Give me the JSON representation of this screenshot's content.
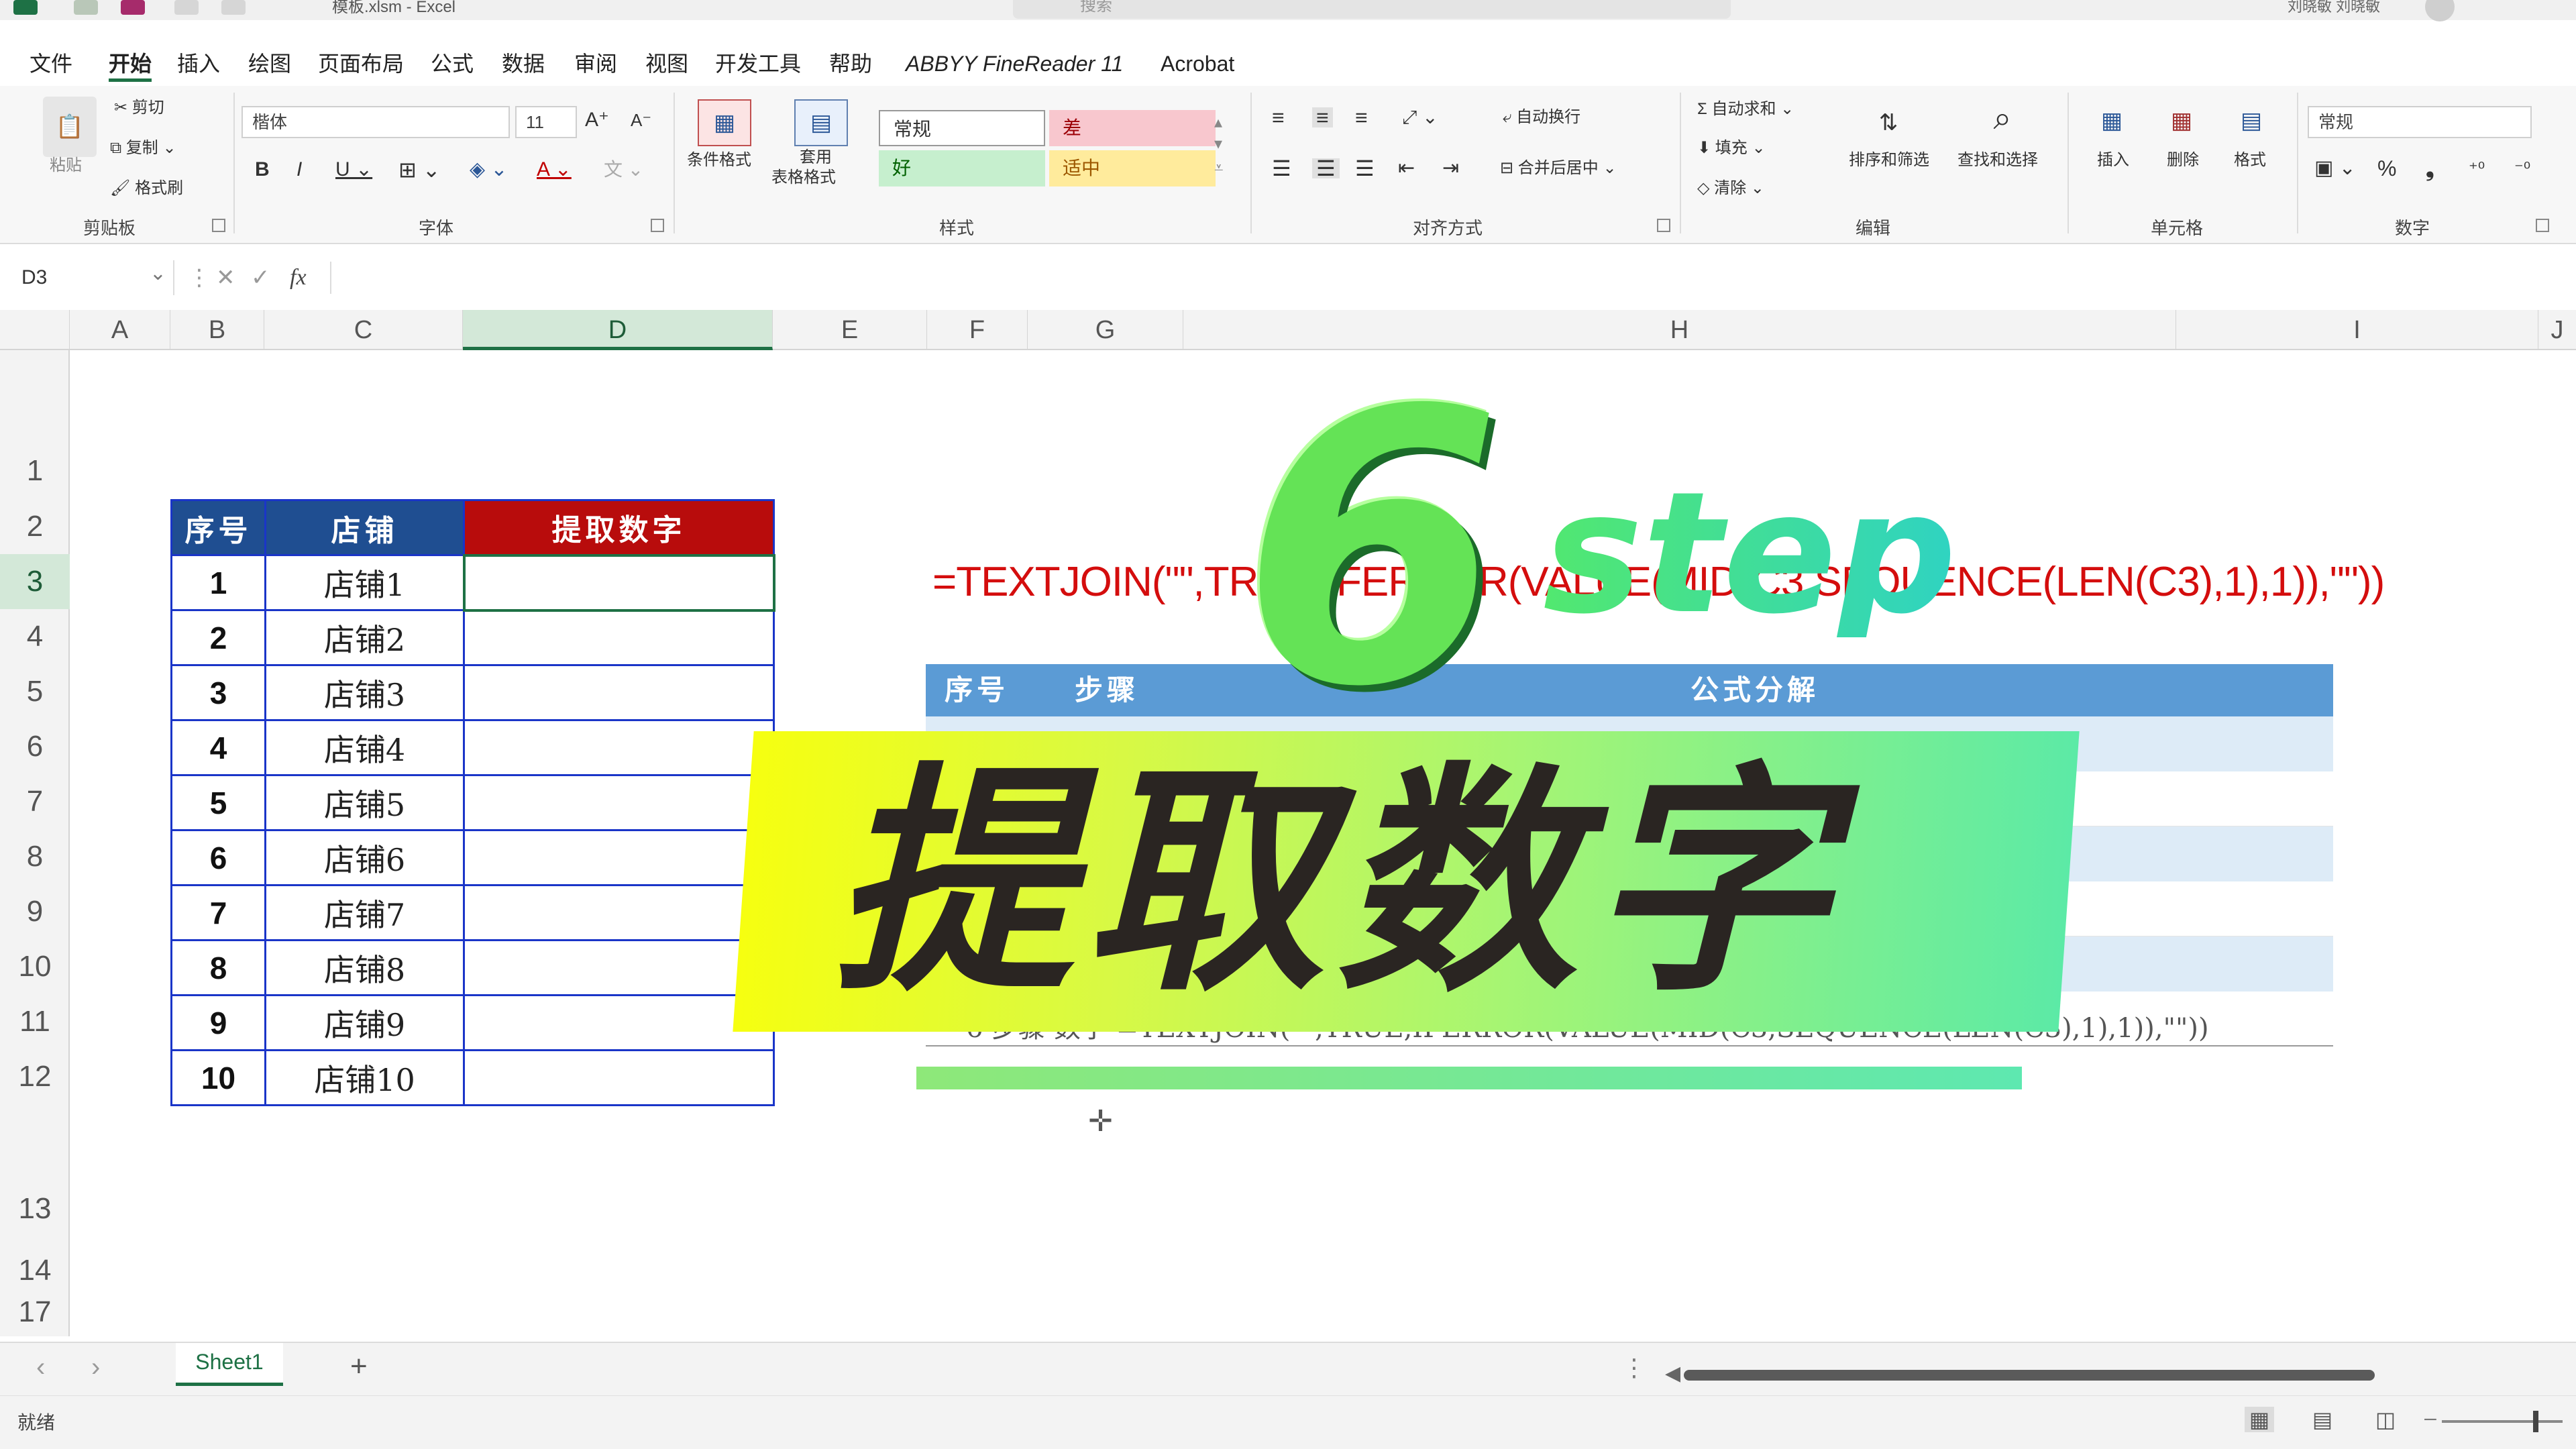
{
  "titlebar": {
    "filename": "模板.xlsm - Excel",
    "search_placeholder": "搜索",
    "user": "刘晓敏 刘晓敏"
  },
  "menu": {
    "tabs": [
      {
        "label": "文件"
      },
      {
        "label": "开始"
      },
      {
        "label": "插入"
      },
      {
        "label": "绘图"
      },
      {
        "label": "页面布局"
      },
      {
        "label": "公式"
      },
      {
        "label": "数据"
      },
      {
        "label": "审阅"
      },
      {
        "label": "视图"
      },
      {
        "label": "开发工具"
      },
      {
        "label": "帮助"
      },
      {
        "label": "ABBYY FineReader 11"
      },
      {
        "label": "Acrobat"
      }
    ]
  },
  "ribbon": {
    "clipboard": {
      "paste": "粘贴",
      "cut": "剪切",
      "copy": "复制",
      "format_painter": "格式刷",
      "group": "剪贴板"
    },
    "font": {
      "family": "楷体",
      "size": "11",
      "group": "字体"
    },
    "styles": {
      "conditional": "条件格式",
      "table_format": "套用\n表格格式",
      "table_format_l1": "套用",
      "table_format_l2": "表格格式",
      "normal": "常规",
      "bad": "差",
      "good": "好",
      "neutral": "适中",
      "group": "样式"
    },
    "alignment": {
      "wrap": "自动换行",
      "merge": "合并后居中",
      "group": "对齐方式"
    },
    "editing": {
      "autosum": "自动求和",
      "fill": "填充",
      "clear": "清除",
      "sort_filter": "排序和筛选",
      "find_select": "查找和选择",
      "group": "编辑"
    },
    "cells": {
      "insert": "插入",
      "delete": "删除",
      "format": "格式",
      "group": "单元格"
    },
    "number": {
      "format": "常规",
      "group": "数字"
    }
  },
  "formula_bar": {
    "name_box": "D3",
    "fx": "fx",
    "cancel": "✕",
    "enter": "✓",
    "more": "⋮"
  },
  "columns": [
    {
      "label": "A"
    },
    {
      "label": "B"
    },
    {
      "label": "C"
    },
    {
      "label": "D"
    },
    {
      "label": "E"
    },
    {
      "label": "F"
    },
    {
      "label": "G"
    },
    {
      "label": "H"
    },
    {
      "label": "I"
    },
    {
      "label": "J"
    }
  ],
  "rows": [
    "1",
    "2",
    "3",
    "4",
    "5",
    "6",
    "7",
    "8",
    "9",
    "10",
    "11",
    "12",
    "13",
    "14",
    "17"
  ],
  "data_table": {
    "headers": {
      "index": "序号",
      "store": "店铺",
      "extract": "提取数字"
    },
    "rows": [
      {
        "index": "1",
        "store": "店铺1"
      },
      {
        "index": "2",
        "store": "店铺2"
      },
      {
        "index": "3",
        "store": "店铺3"
      },
      {
        "index": "4",
        "store": "店铺4"
      },
      {
        "index": "5",
        "store": "店铺5"
      },
      {
        "index": "6",
        "store": "店铺6"
      },
      {
        "index": "7",
        "store": "店铺7"
      },
      {
        "index": "8",
        "store": "店铺8"
      },
      {
        "index": "9",
        "store": "店铺9"
      },
      {
        "index": "10",
        "store": "店铺10"
      }
    ]
  },
  "formula_display": "=TEXTJOIN(\"\",TRUE,IFERROR(VALUE(MID(C3,SEQUENCE(LEN(C3),1),1)),\"\"))",
  "steps_table": {
    "headers": {
      "index": "序号",
      "step": "步骤",
      "breakdown": "公式分解"
    },
    "last_row": "6  步骤 数字 =TEXTJOIN(\"\",TRUE,IFERROR(VALUE(MID(C3,SEQUENCE(LEN(C3),1),1)),\"\"))"
  },
  "overlay": {
    "big_number": "6",
    "step_word": "step",
    "banner_title": "提取数字",
    "colors": {
      "green": "#64e356",
      "banner_start": "#f6ff10",
      "banner_end": "#5ceaa6"
    }
  },
  "sheets": {
    "tabs": [
      {
        "label": "Sheet1"
      }
    ],
    "add": "+"
  },
  "status": {
    "text": "就绪"
  }
}
